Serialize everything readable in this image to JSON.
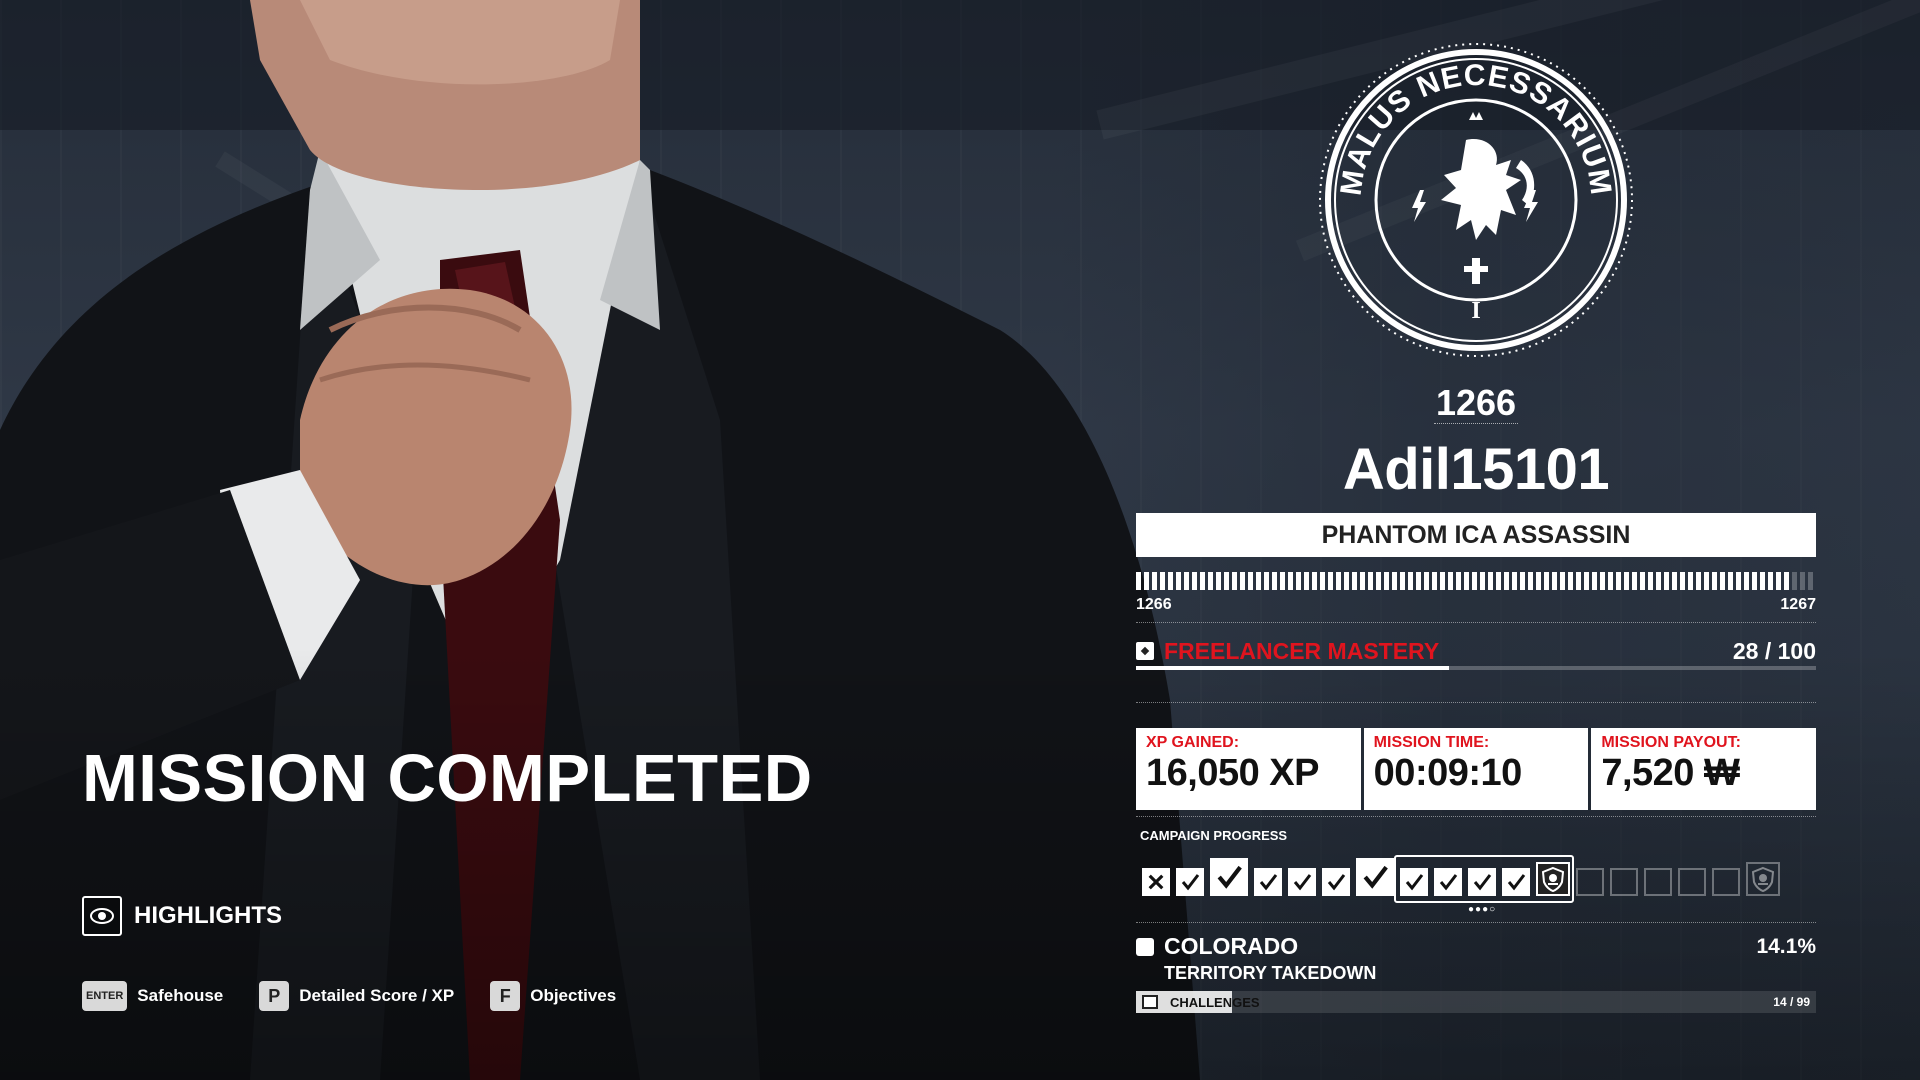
{
  "mission": {
    "title": "MISSION COMPLETED",
    "highlights_label": "HIGHLIGHTS"
  },
  "controls": [
    {
      "key": "ENTER",
      "label": "Safehouse"
    },
    {
      "key": "P",
      "label": "Detailed Score / XP"
    },
    {
      "key": "F",
      "label": "Objectives"
    }
  ],
  "profile": {
    "emblem_text": "MALUS NECESSARIUM",
    "emblem_numeral": "I",
    "level": "1266",
    "username": "Adil15101",
    "rank_title": "PHANTOM ICA ASSASSIN",
    "xp_progress": 0.96,
    "level_current": "1266",
    "level_next": "1267"
  },
  "mastery": {
    "label": "FREELANCER MASTERY",
    "count": "28 / 100",
    "progress": 0.46
  },
  "stats": [
    {
      "label": "XP GAINED:",
      "value": "16,050 XP"
    },
    {
      "label": "MISSION TIME:",
      "value": "00:09:10"
    },
    {
      "label": "MISSION PAYOUT:",
      "value": "7,520 ₩"
    }
  ],
  "campaign": {
    "label": "CAMPAIGN PROGRESS",
    "cells": [
      "failed",
      "done",
      "done-big",
      "done",
      "done",
      "done",
      "done-big",
      "done",
      "done",
      "done",
      "done",
      "boss-done",
      "empty",
      "empty",
      "empty",
      "empty",
      "empty",
      "boss-empty"
    ]
  },
  "location": {
    "name": "COLORADO",
    "percent": "14.1%",
    "subtitle": "TERRITORY TAKEDOWN",
    "challenges_label": "CHALLENGES",
    "challenges_count": "14 / 99",
    "challenges_progress": 0.141
  },
  "colors": {
    "accent_red": "#e0141e",
    "panel_white": "#ffffff",
    "background": "#252d39"
  },
  "icons": {
    "highlights": "nvidia-highlights-icon",
    "mastery": "freelancer-mastery-icon",
    "location": "location-icon",
    "challenges": "challenges-icon",
    "boss": "skull-shield-icon"
  }
}
